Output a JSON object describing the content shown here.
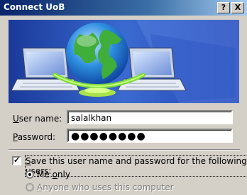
{
  "window": {
    "title": "Connect UoB",
    "help_label": "?",
    "close_label": "X"
  },
  "form": {
    "username_label_first": "U",
    "username_label_rest": "ser name:",
    "username_value": "salalkhan",
    "password_label_first": "P",
    "password_label_rest": "assword:",
    "password_value": "●●●●●●●●",
    "save_label_first": "S",
    "save_label_rest": "ave this user name and password for the following users:",
    "save_checked": true,
    "radio_me_first": "Me ",
    "radio_me_ul": "o",
    "radio_me_rest": "nly",
    "radio_anyone_ul": "A",
    "radio_anyone_rest": "nyone who uses this computer"
  },
  "colors": {
    "titlebar": "#0a246a",
    "dialog": "#d4d0c8",
    "banner": "#1e3c9e"
  }
}
